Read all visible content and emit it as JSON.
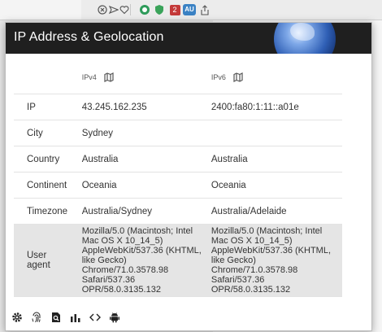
{
  "popup": {
    "title": "IP Address & Geolocation"
  },
  "table": {
    "columns": [
      {
        "label": "IPv4",
        "icon": "map-icon"
      },
      {
        "label": "IPv6",
        "icon": "map-icon"
      }
    ],
    "rows": [
      {
        "label": "IP",
        "ipv4": "43.245.162.235",
        "ipv6": "2400:fa80:1:11::a01e"
      },
      {
        "label": "City",
        "ipv4": "Sydney",
        "ipv6": ""
      },
      {
        "label": "Country",
        "ipv4": "Australia",
        "ipv6": "Australia"
      },
      {
        "label": "Continent",
        "ipv4": "Oceania",
        "ipv6": "Oceania"
      },
      {
        "label": "Timezone",
        "ipv4": "Australia/Sydney",
        "ipv6": "Australia/Adelaide"
      }
    ],
    "user_agent": {
      "label": "User agent",
      "ipv4_lines": [
        "Mozilla/5.0 (Macintosh; Intel",
        "Mac OS X 10_14_5)",
        "AppleWebKit/537.36 (KHTML,",
        "like Gecko)",
        "Chrome/71.0.3578.98",
        "Safari/537.36",
        "OPR/58.0.3135.132"
      ],
      "ipv6_lines": [
        "Mozilla/5.0 (Macintosh; Intel",
        "Mac OS X 10_14_5)",
        "AppleWebKit/537.36 (KHTML,",
        "like Gecko)",
        "Chrome/71.0.3578.98",
        "Safari/537.36",
        "OPR/58.0.3135.132"
      ]
    }
  },
  "toolbar": {
    "badge_count": "2",
    "ext_badge": "AU"
  },
  "bottom_icons": [
    "gear-icon",
    "fingerprint-icon",
    "page-search-icon",
    "bar-chart-icon",
    "code-icon",
    "android-icon"
  ],
  "colors": {
    "header_bg": "#1f1f1f",
    "ua_row_bg": "#e5e5e5",
    "ext_badge_bg": "#3b82c4"
  }
}
